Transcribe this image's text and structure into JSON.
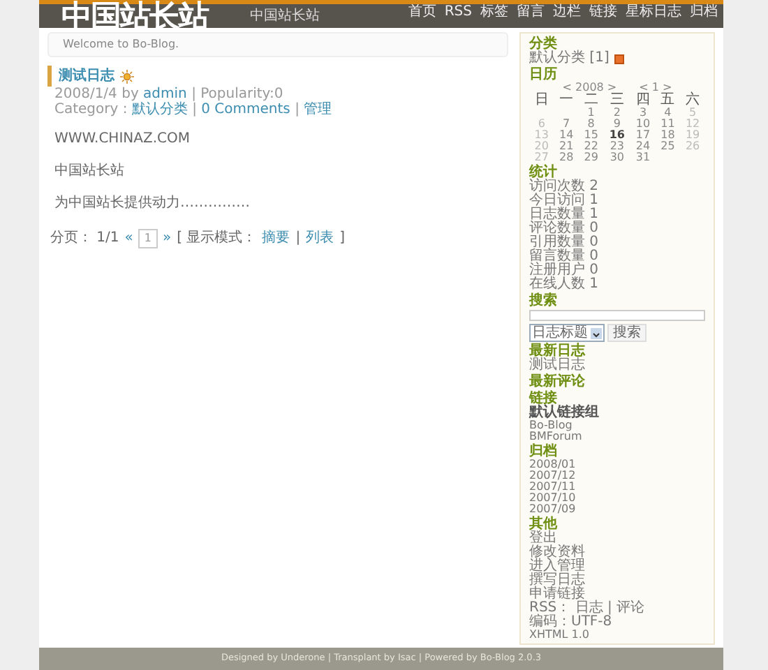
{
  "header": {
    "logo": "中国站长站",
    "subtitle": "中国站长站",
    "nav": [
      "首页",
      "RSS",
      "标签",
      "留言",
      "边栏",
      "链接",
      "星标日志",
      "归档"
    ]
  },
  "welcome": "Welcome to Bo-Blog.",
  "post": {
    "title": "测试日志",
    "meta1": [
      {
        "text": "2008/1/4 by ",
        "link": false
      },
      {
        "text": "admin",
        "link": true
      },
      {
        "text": " | Popularity:0",
        "link": false
      }
    ],
    "meta2": [
      {
        "text": "Category : ",
        "link": false
      },
      {
        "text": "默认分类",
        "link": true
      },
      {
        "text": " | ",
        "link": false
      },
      {
        "text": "0 Comments",
        "link": true
      },
      {
        "text": " | ",
        "link": false
      },
      {
        "text": "管理",
        "link": true
      }
    ],
    "paragraphs": [
      "WWW.CHINAZ.COM",
      "中国站长站",
      "为中国站长提供动力……………"
    ]
  },
  "pager": {
    "label": "分页： 1/1",
    "prev": "«",
    "page": "1",
    "next": "»",
    "open": "[ 显示模式：",
    "modes": [
      "摘要",
      "列表"
    ],
    "sep": "|",
    "close": "]"
  },
  "sidebar": [
    {
      "kind": "list",
      "title": "分类",
      "items": [
        {
          "text": "默认分类 [1]",
          "rss": true
        }
      ]
    },
    {
      "kind": "calendar",
      "title": "日历",
      "year": "< 2008 >",
      "month": "< 1 >",
      "weekdays": [
        "日",
        "一",
        "二",
        "三",
        "四",
        "五",
        "六"
      ],
      "weeks": [
        [
          "1",
          "2",
          "3",
          "4",
          "5"
        ],
        [
          "6",
          "7",
          "8",
          "9",
          "10",
          "11",
          "12"
        ],
        [
          "13",
          "14",
          "15",
          {
            "day": "16",
            "today": true
          },
          "17",
          "18",
          "19"
        ],
        [
          "20",
          "21",
          "22",
          "23",
          "24",
          "25",
          "26"
        ],
        [
          "27",
          "28",
          "29",
          "30",
          "31"
        ]
      ]
    },
    {
      "kind": "list",
      "title": "统计",
      "items": [
        {
          "text": "访问次数 2"
        },
        {
          "text": "今日访问 1"
        },
        {
          "text": "日志数量 1"
        },
        {
          "text": "评论数量 0"
        },
        {
          "text": "引用数量 0"
        },
        {
          "text": "留言数量 0"
        },
        {
          "text": "注册用户 0"
        },
        {
          "text": "在线人数 1"
        }
      ]
    },
    {
      "kind": "search",
      "title": "搜索",
      "option": "日志标题",
      "button": "搜索"
    },
    {
      "kind": "list",
      "title": "最新日志",
      "items": [
        {
          "text": "测试日志"
        }
      ]
    },
    {
      "kind": "list",
      "title": "最新评论"
    },
    {
      "kind": "list",
      "title": "链接",
      "group": "默认链接组",
      "items": [
        {
          "text": "Bo-Blog"
        },
        {
          "text": "BMForum"
        }
      ]
    },
    {
      "kind": "list",
      "title": "归档",
      "items": [
        {
          "text": "2008/01"
        },
        {
          "text": "2007/12"
        },
        {
          "text": "2007/11"
        },
        {
          "text": "2007/10"
        },
        {
          "text": "2007/09"
        }
      ]
    },
    {
      "kind": "list",
      "title": "其他",
      "items": [
        {
          "text": "登出"
        },
        {
          "text": "修改资料"
        },
        {
          "text": "进入管理"
        },
        {
          "text": "撰写日志"
        },
        {
          "text": "申请链接"
        },
        {
          "text": "RSS： 日志 | 评论"
        },
        {
          "text": "编码：UTF-8"
        },
        {
          "text": "XHTML 1.0"
        }
      ]
    }
  ],
  "footer": "Designed by Underone | Transplant by Isac | Powered by Bo-Blog 2.0.3"
}
